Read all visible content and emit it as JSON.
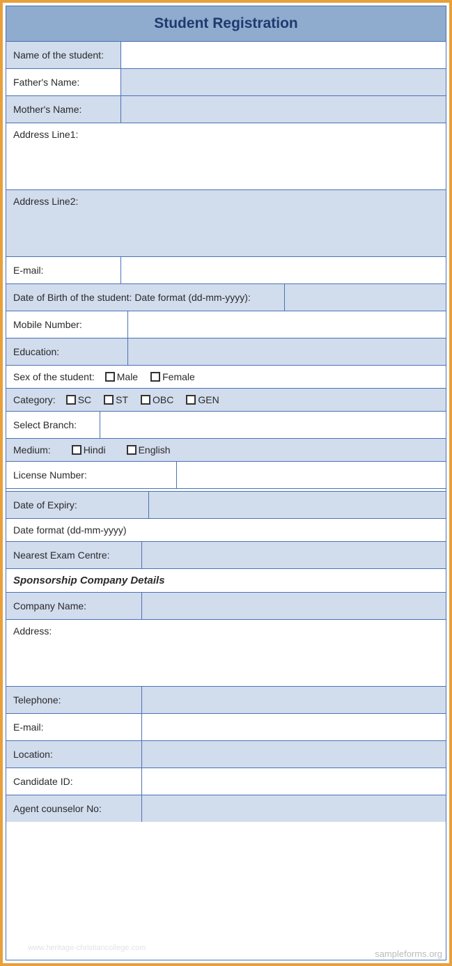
{
  "title": "Student Registration",
  "fields": {
    "name_label": "Name of the student:",
    "father_label": "Father's Name:",
    "mother_label": "Mother's Name:",
    "addr1_label": "Address Line1:",
    "addr2_label": "Address Line2:",
    "email_label": "E-mail:",
    "dob_label": "Date of Birth of the student: Date format (dd-mm-yyyy):",
    "mobile_label": "Mobile Number:",
    "education_label": "Education:",
    "sex_label": "Sex of the student:",
    "sex_options": {
      "male": "Male",
      "female": "Female"
    },
    "category_label": "Category:",
    "category_options": {
      "sc": "SC",
      "st": "ST",
      "obc": "OBC",
      "gen": "GEN"
    },
    "branch_label": "Select Branch:",
    "medium_label": "Medium:",
    "medium_options": {
      "hindi": "Hindi",
      "english": "English"
    },
    "license_label": "License Number:",
    "expiry_label": "Date of Expiry:",
    "date_format_label": "Date format (dd-mm-yyyy)",
    "exam_centre_label": "Nearest Exam Centre:",
    "sponsor_header": "Sponsorship Company Details",
    "company_name_label": "Company Name:",
    "address_label": "Address:",
    "telephone_label": "Telephone:",
    "email2_label": "E-mail:",
    "location_label": "Location:",
    "candidate_id_label": "Candidate ID:",
    "agent_label": "Agent counselor No:"
  },
  "watermark_left": "www.heritage-christiancollege.com",
  "watermark_right": "sampleforms.org"
}
